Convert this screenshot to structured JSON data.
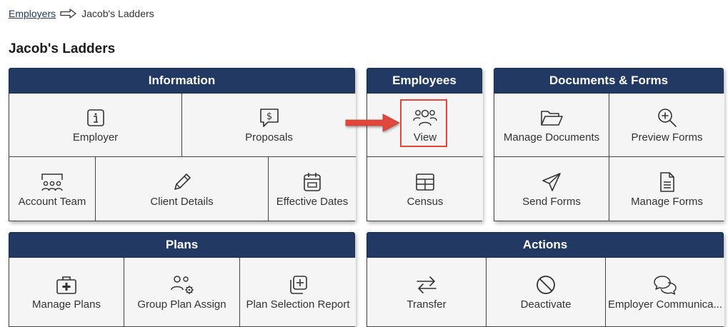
{
  "breadcrumb": {
    "parent": "Employers",
    "current": "Jacob's Ladders"
  },
  "page_title": "Jacob's Ladders",
  "panels": {
    "information": {
      "title": "Information",
      "items": [
        "Employer",
        "Proposals",
        "Account Team",
        "Client Details",
        "Effective Dates"
      ]
    },
    "employees": {
      "title": "Employees",
      "items": [
        "View",
        "Census"
      ]
    },
    "documents": {
      "title": "Documents & Forms",
      "items": [
        "Manage Documents",
        "Preview Forms",
        "Send Forms",
        "Manage Forms"
      ]
    },
    "plans": {
      "title": "Plans",
      "items": [
        "Manage Plans",
        "Group Plan Assign",
        "Plan Selection Report"
      ]
    },
    "actions": {
      "title": "Actions",
      "items": [
        "Transfer",
        "Deactivate",
        "Employer Communica..."
      ]
    }
  },
  "colors": {
    "header": "#223a63",
    "highlight": "#e0473e",
    "cell_bg": "#f5f5f5"
  }
}
